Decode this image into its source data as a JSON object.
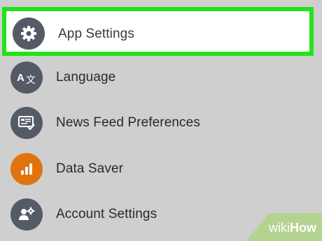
{
  "menu": {
    "items": [
      {
        "label": "App Settings",
        "icon": "gear-icon",
        "highlighted": true
      },
      {
        "label": "Language",
        "icon": "translate-icon"
      },
      {
        "label": "News Feed Preferences",
        "icon": "news-feed-icon"
      },
      {
        "label": "Data Saver",
        "icon": "bar-chart-icon",
        "icon_color": "#e0730f"
      },
      {
        "label": "Account Settings",
        "icon": "account-gear-icon"
      }
    ],
    "highlight_color": "#22e31a",
    "icon_color": "#545b67"
  },
  "watermark": {
    "prefix": "wiki",
    "suffix": "How"
  }
}
